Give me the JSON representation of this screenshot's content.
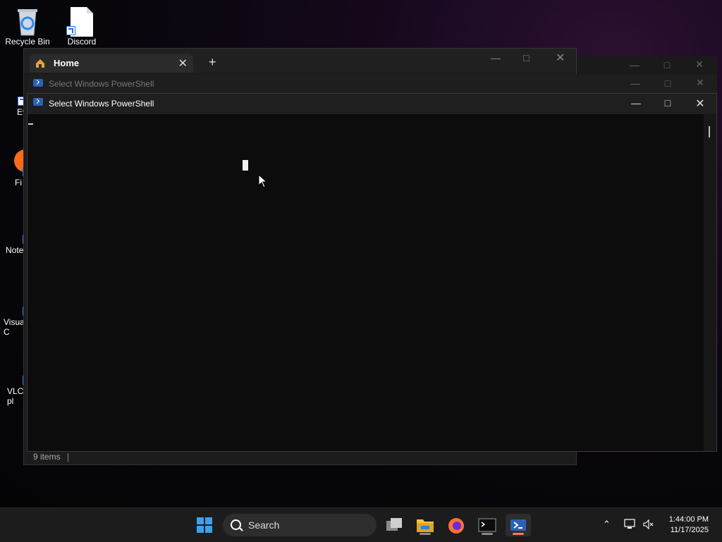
{
  "desktop": {
    "icons": [
      {
        "label": "Recycle Bin"
      },
      {
        "label": "Discord"
      },
      {
        "label": "Ever"
      },
      {
        "label": "Fi"
      },
      {
        "label": "Note"
      },
      {
        "label": "Visua\nC"
      },
      {
        "label": "VLC\npl"
      }
    ]
  },
  "explorer": {
    "tab_title": "Home",
    "status_items": "9 items"
  },
  "powershell_back": {
    "title": "Select Windows PowerShell"
  },
  "powershell_front": {
    "title": "Select Windows PowerShell"
  },
  "taskbar": {
    "search_label": "Search",
    "time": "1:44:00 PM",
    "date": "11/17/2025"
  },
  "colors": {
    "accent": "#0078d4",
    "ps_blue": "#2b62b6"
  }
}
